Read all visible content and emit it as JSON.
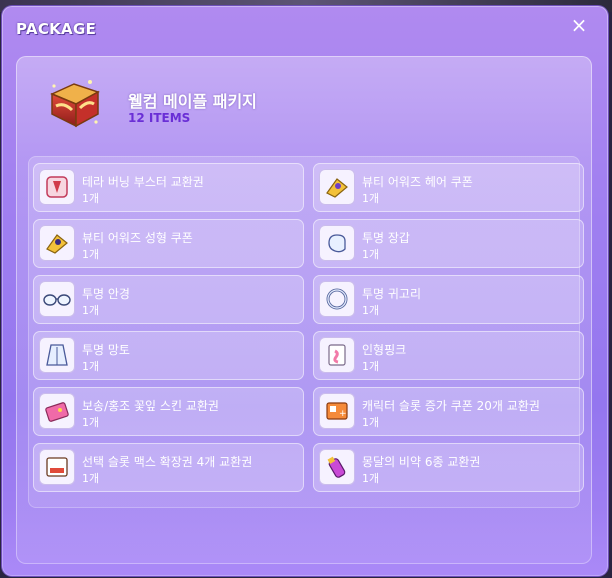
{
  "window": {
    "title": "PACKAGE",
    "close_label": "×"
  },
  "package": {
    "name": "웰컴 메이플 패키지",
    "count": "12 ITEMS"
  },
  "items": [
    {
      "name": "테라 버닝 부스터 교환권",
      "qty": "1개",
      "icon": "burning-booster-icon"
    },
    {
      "name": "뷰티 어워즈 헤어 쿠폰",
      "qty": "1개",
      "icon": "hair-coupon-icon"
    },
    {
      "name": "뷰티 어워즈 성형 쿠폰",
      "qty": "1개",
      "icon": "face-coupon-icon"
    },
    {
      "name": "투명 장갑",
      "qty": "1개",
      "icon": "glove-icon"
    },
    {
      "name": "투명 안경",
      "qty": "1개",
      "icon": "glasses-icon"
    },
    {
      "name": "투명 귀고리",
      "qty": "1개",
      "icon": "earring-icon"
    },
    {
      "name": "투명 망토",
      "qty": "1개",
      "icon": "cape-icon"
    },
    {
      "name": "인형핑크",
      "qty": "1개",
      "icon": "doll-pink-icon"
    },
    {
      "name": "보송/홍조 꽃잎 스킨 교환권",
      "qty": "1개",
      "icon": "skin-voucher-icon"
    },
    {
      "name": "캐릭터 슬롯 증가 쿠폰 20개 교환권",
      "qty": "1개",
      "icon": "slot-coupon-icon"
    },
    {
      "name": "선택 슬롯 맥스 확장권 4개 교환권",
      "qty": "1개",
      "icon": "slot-max-icon"
    },
    {
      "name": "몽달의 비약 6종 교환권",
      "qty": "1개",
      "icon": "potion-icon"
    }
  ],
  "colors": {
    "accent": "#6a2fd6",
    "window_bg": "#a07ff0"
  }
}
